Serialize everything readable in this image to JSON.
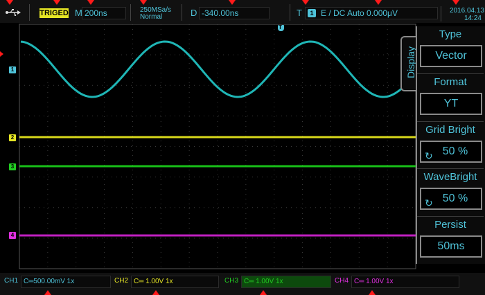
{
  "status_bar": {
    "trigger_state": "TRIGED",
    "timebase_label": "M",
    "timebase_value": "200ns",
    "sample_rate": "250MSa/s",
    "acq_mode": "Normal",
    "delay_label": "D",
    "delay_value": "-340.00ns",
    "trigger_label": "T",
    "trigger_channel": "1",
    "trigger_settings": "E  / DC Auto 0.000μV",
    "date": "2016.04.13",
    "time": "14:24",
    "usb_icon": "usb-icon"
  },
  "channels": [
    {
      "id": "1",
      "label": "CH1",
      "setting": "C═500.00mV 1x",
      "color": "#4fc3d9"
    },
    {
      "id": "2",
      "label": "CH2",
      "setting": "C═ 1.00V 1x",
      "color": "#e5e525"
    },
    {
      "id": "3",
      "label": "CH3",
      "setting": "C═ 1.00V 1x",
      "color": "#22cc22"
    },
    {
      "id": "4",
      "label": "CH4",
      "setting": "C═ 1.00V 1x",
      "color": "#e030e0"
    }
  ],
  "trigger_marker": "T",
  "menu": {
    "tab": "Display",
    "items": [
      {
        "title": "Type",
        "value": "Vector",
        "knob": false
      },
      {
        "title": "Format",
        "value": "YT",
        "knob": false
      },
      {
        "title": "Grid Bright",
        "value": "50 %",
        "knob": true
      },
      {
        "title": "WaveBright",
        "value": "50 %",
        "knob": true
      },
      {
        "title": "Persist",
        "value": "50ms",
        "knob": false
      }
    ]
  },
  "colors": {
    "accent": "#4fc3d9",
    "triged_bg": "#e5e525",
    "marker": "#ff1a1a"
  }
}
